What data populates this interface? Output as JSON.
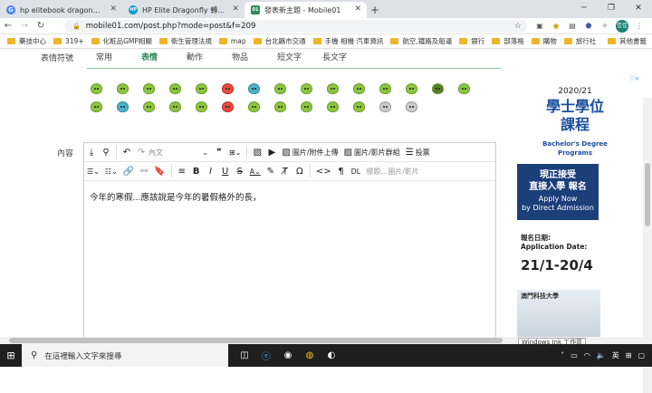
{
  "browser": {
    "tabs": [
      {
        "label": "hp elitebook dragonfly - Goog",
        "fav": "G",
        "favcolor": "#4285f4",
        "active": false
      },
      {
        "label": "HP Elite Dragonfly 轉換式 2 合",
        "fav": "HP",
        "favcolor": "#0096d6",
        "active": false
      },
      {
        "label": "發表新主題 - Mobile01",
        "fav": "01",
        "favcolor": "#2e8b57",
        "active": true
      }
    ],
    "url": "mobile01.com/post.php?mode=post&f=209",
    "profile": "佳佳",
    "bookmarks": [
      "藥技中心",
      "319+",
      "化粧品GMP相關",
      "衛生管理法規",
      "map",
      "台北縣市交通",
      "手機 相機 汽車資訊",
      "航空,鐵路及船運",
      "銀行",
      "部落格",
      "購物",
      "旅行社",
      "其他書籤"
    ]
  },
  "form": {
    "emoji_label": "表情符號",
    "emoji_tabs": [
      "常用",
      "表情",
      "動作",
      "物品",
      "短文字",
      "長文字"
    ],
    "content_label": "內容"
  },
  "editor": {
    "font_select": "內文",
    "image_upload": "圖片/附件上傳",
    "image_group": "圖片/影片群組",
    "vote": "投票",
    "dl": "DL",
    "caption": "標題…圖片/影片",
    "text": "今年的寒假...應該說是今年的暑假格外的長，"
  },
  "ad": {
    "year": "2020/21",
    "title1": "學士學位",
    "title2": "課程",
    "en1": "Bachelor's Degree",
    "en2": "Programs",
    "box1": "現正接受",
    "box2": "直接入學 報名",
    "box3": "Apply Now",
    "box4": "by Direct Admission",
    "date_label1": "報名日期:",
    "date_label2": "Application Date:",
    "dates": "21/1-20/4",
    "school": "澳門科技大學"
  },
  "tooltip": "Windows Ink 工作區",
  "taskbar": {
    "search_placeholder": "在這裡輸入文字來搜尋",
    "ime": "英"
  }
}
